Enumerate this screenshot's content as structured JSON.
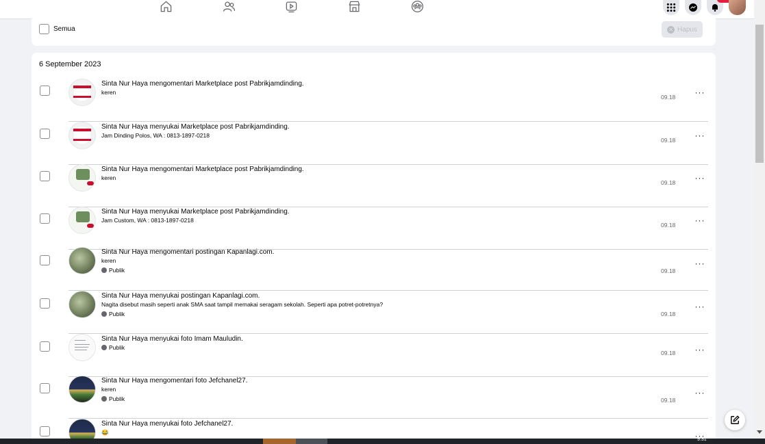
{
  "topbar": {
    "nav_icons": [
      "home-icon",
      "friends-icon",
      "video-icon",
      "marketplace-icon",
      "groups-icon"
    ],
    "right_icons": [
      "menu-grid-icon",
      "messenger-icon",
      "notifications-icon",
      "profile-avatar"
    ]
  },
  "selection": {
    "select_all_label": "Semua",
    "delete_label": "Hapus"
  },
  "activity": {
    "date": "6 September 2023",
    "items": [
      {
        "title": "Sinta Nur Haya mengomentari Marketplace post Pabrikjamdinding.",
        "sub": "keren",
        "privacy": "",
        "time": "09.18",
        "thumb": "poster"
      },
      {
        "title": "Sinta Nur Haya menyukai Marketplace post Pabrikjamdinding.",
        "sub": "Jam Dinding Polos, WA : 0813-1897-0218",
        "privacy": "",
        "time": "09.18",
        "thumb": "poster"
      },
      {
        "title": "Sinta Nur Haya mengomentari Marketplace post Pabrikjamdinding.",
        "sub": "keren",
        "privacy": "",
        "time": "09.18",
        "thumb": "green"
      },
      {
        "title": "Sinta Nur Haya menyukai Marketplace post Pabrikjamdinding.",
        "sub": "Jam Custom, WA : 0813-1897-0218",
        "privacy": "",
        "time": "09.18",
        "thumb": "green"
      },
      {
        "title": "Sinta Nur Haya mengomentari postingan Kapanlagi.com.",
        "sub": "keren",
        "privacy": "Publik",
        "time": "09.18",
        "thumb": "photo"
      },
      {
        "title": "Sinta Nur Haya menyukai postingan Kapanlagi.com.",
        "sub": "Nagita disebut masih seperti anak SMA saat tampil memakai seragam sekolah. Seperti apa potret-potretnya?",
        "privacy": "Publik",
        "time": "09.18",
        "thumb": "photo"
      },
      {
        "title": "Sinta Nur Haya menyukai foto Imam Mauludin.",
        "sub": "",
        "privacy": "Publik",
        "time": "09.18",
        "thumb": "doc"
      },
      {
        "title": "Sinta Nur Haya mengomentari foto Jefchanel27.",
        "sub": "keren",
        "privacy": "Publik",
        "time": "09.18",
        "thumb": "night"
      },
      {
        "title": "Sinta Nur Haya menyukai foto Jefchanel27.",
        "sub": "😂",
        "privacy": "",
        "time": "",
        "thumb": "night"
      }
    ]
  },
  "more_label": "···",
  "taskbar_clock": "9.31",
  "colors": {
    "accent_red": "#e41e3f",
    "divider": "#ced0d4",
    "muted": "#65676b"
  }
}
